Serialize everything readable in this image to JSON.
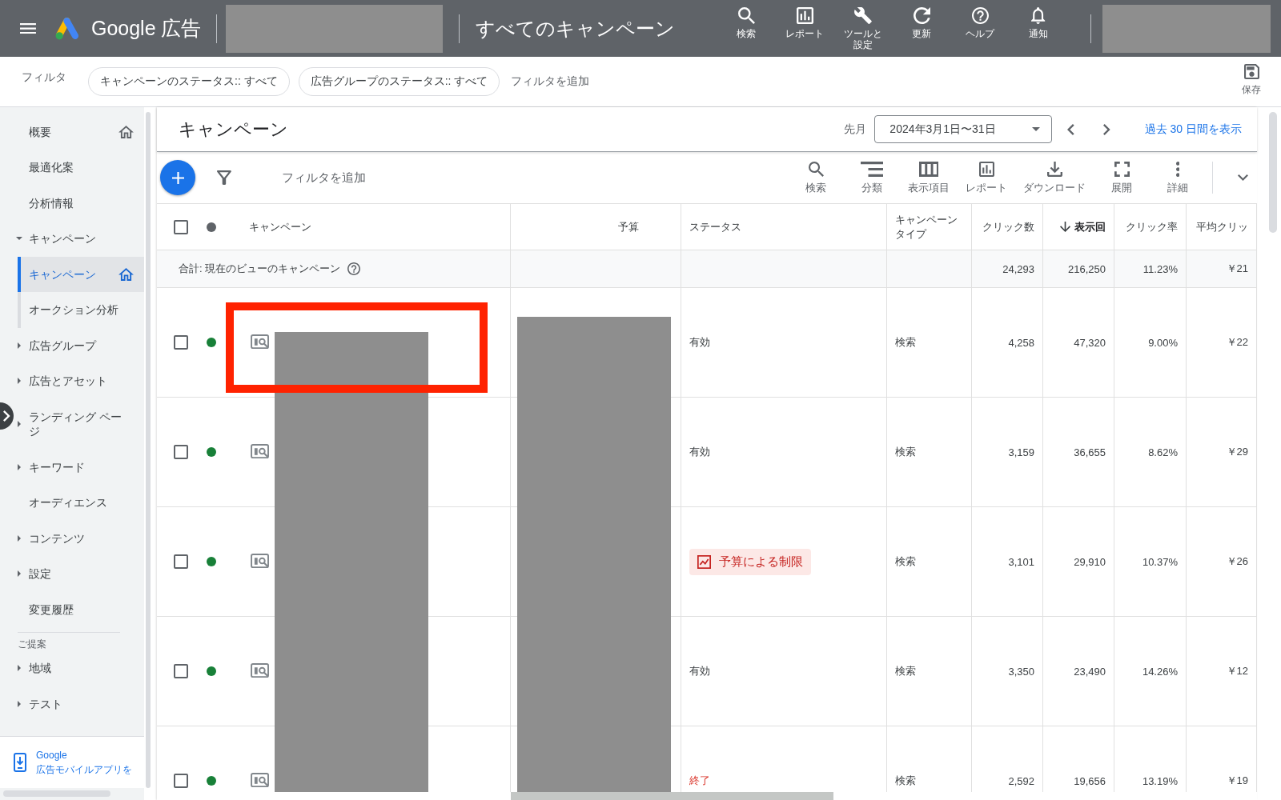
{
  "top_bar": {
    "brand": "Google 広告",
    "page_title": "すべてのキャンペーン",
    "tools": [
      {
        "label": "検索",
        "kind": "search"
      },
      {
        "label": "レポート",
        "kind": "report"
      },
      {
        "label": "ツールと設定",
        "kind": "tools"
      },
      {
        "label": "更新",
        "kind": "refresh"
      },
      {
        "label": "ヘルプ",
        "kind": "help"
      },
      {
        "label": "通知",
        "kind": "notifications"
      }
    ]
  },
  "filter_bar": {
    "label": "フィルタ",
    "chips": [
      "キャンペーンのステータス:: すべて",
      "広告グループのステータス:: すべて"
    ],
    "add_filter": "フィルタを追加",
    "save": "保存"
  },
  "sidebar": {
    "items": [
      {
        "label": "概要",
        "kind": "link",
        "home": true,
        "selected": false
      },
      {
        "label": "最適化案",
        "kind": "link",
        "selected": false
      },
      {
        "label": "分析情報",
        "kind": "link",
        "selected": false
      },
      {
        "label": "キャンペーン",
        "kind": "group",
        "expanded": true,
        "selected": false,
        "children": [
          {
            "label": "キャンペーン",
            "home": true,
            "selected": true
          },
          {
            "label": "オークション分析",
            "selected": false
          }
        ]
      },
      {
        "label": "広告グループ",
        "kind": "group",
        "expanded": false,
        "selected": false
      },
      {
        "label": "広告とアセット",
        "kind": "group",
        "expanded": false,
        "selected": false
      },
      {
        "label": "ランディング ページ",
        "kind": "group",
        "expanded": false,
        "selected": false
      },
      {
        "label": "キーワード",
        "kind": "group",
        "expanded": false,
        "selected": false
      },
      {
        "label": "オーディエンス",
        "kind": "link",
        "selected": false
      },
      {
        "label": "コンテンツ",
        "kind": "group",
        "expanded": false,
        "selected": false
      },
      {
        "label": "設定",
        "kind": "group",
        "expanded": false,
        "selected": false
      },
      {
        "label": "変更履歴",
        "kind": "link",
        "selected": false
      }
    ],
    "suggestions_heading": "ご提案",
    "suggestions": [
      {
        "label": "地域",
        "kind": "group",
        "expanded": false,
        "selected": false
      },
      {
        "label": "テスト",
        "kind": "group",
        "expanded": false,
        "selected": false
      }
    ],
    "app_promo": [
      "Google",
      "広告モバイルアプリを"
    ]
  },
  "campaigns": {
    "title": "キャンペーン",
    "period_label": "先月",
    "date_range": "2024年3月1日〜31日",
    "recent_link": "過去 30 日間を表示"
  },
  "toolbar": {
    "add_filter": "フィルタを追加",
    "tools": [
      {
        "label": "検索",
        "kind": "search"
      },
      {
        "label": "分類",
        "kind": "segment"
      },
      {
        "label": "表示項目",
        "kind": "columns"
      },
      {
        "label": "レポート",
        "kind": "report"
      },
      {
        "label": "ダウンロード",
        "kind": "download"
      },
      {
        "label": "展開",
        "kind": "expand"
      },
      {
        "label": "詳細",
        "kind": "more"
      }
    ]
  },
  "table": {
    "select_all": {
      "checked": false
    },
    "columns": [
      {
        "label": "キャンペーン",
        "kind": "name",
        "sorted": false
      },
      {
        "label": "予算",
        "kind": "budget",
        "sorted": false
      },
      {
        "label": "ステータス",
        "kind": "status",
        "sorted": false
      },
      {
        "label": "キャンペーンタイプ",
        "kind": "type",
        "sorted": false
      },
      {
        "label": "クリック数",
        "kind": "metric",
        "sorted": false
      },
      {
        "label": "表示回",
        "kind": "metric",
        "sorted": true
      },
      {
        "label": "クリック率",
        "kind": "metric",
        "sorted": false
      },
      {
        "label": "平均クリッ",
        "kind": "metric",
        "sorted": false
      }
    ],
    "totals": {
      "label": "合計: 現在のビューのキャンペーン",
      "clicks": "24,293",
      "impressions": "216,250",
      "ctr": "11.23%",
      "avg_cpc": "￥21"
    },
    "rows": [
      {
        "checked": false,
        "enabled": true,
        "status": {
          "text": "有効",
          "kind": "eligible"
        },
        "type": "検索",
        "clicks": "4,258",
        "impressions": "47,320",
        "ctr": "9.00%",
        "avg_cpc": "￥22"
      },
      {
        "checked": false,
        "enabled": true,
        "status": {
          "text": "有効",
          "kind": "eligible"
        },
        "type": "検索",
        "clicks": "3,159",
        "impressions": "36,655",
        "ctr": "8.62%",
        "avg_cpc": "￥29"
      },
      {
        "checked": false,
        "enabled": true,
        "status": {
          "text": "予算による制限",
          "kind": "limited"
        },
        "type": "検索",
        "clicks": "3,101",
        "impressions": "29,910",
        "ctr": "10.37%",
        "avg_cpc": "￥26"
      },
      {
        "checked": false,
        "enabled": true,
        "status": {
          "text": "有効",
          "kind": "eligible"
        },
        "type": "検索",
        "clicks": "3,350",
        "impressions": "23,490",
        "ctr": "14.26%",
        "avg_cpc": "￥12"
      },
      {
        "checked": false,
        "enabled": true,
        "status": {
          "text": "終了",
          "kind": "ended"
        },
        "type": "検索",
        "clicks": "2,592",
        "impressions": "19,656",
        "ctr": "13.19%",
        "avg_cpc": "￥19"
      }
    ]
  }
}
